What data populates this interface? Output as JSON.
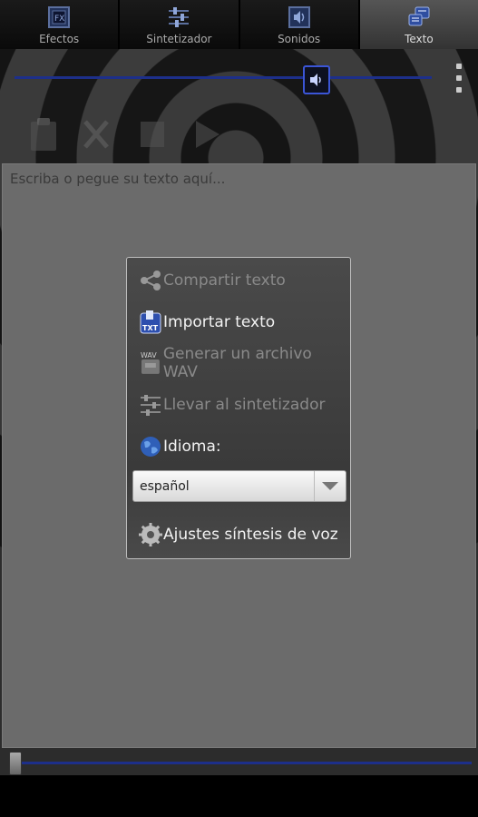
{
  "tabs": [
    {
      "label": "Efectos",
      "icon": "fx-icon",
      "active": false
    },
    {
      "label": "Sintetizador",
      "icon": "sliders-icon",
      "active": false
    },
    {
      "label": "Sonidos",
      "icon": "speaker-icon",
      "active": false
    },
    {
      "label": "Texto",
      "icon": "text-bubble-icon",
      "active": true
    }
  ],
  "editor": {
    "placeholder": "Escriba o pegue su texto aquí..."
  },
  "menu": {
    "share": "Compartir texto",
    "import": "Importar texto",
    "import_badge": "TXT",
    "wav": "Generar un archivo WAV",
    "wav_badge": "WAV",
    "send_synth": "Llevar al sintetizador",
    "language_label": "Idioma:",
    "language_value": "español",
    "tts_settings": "Ajustes síntesis de voz"
  },
  "colors": {
    "accent": "#1d2f8a",
    "knob_border": "#3b55d6",
    "text_area": "#6b6b6b"
  }
}
